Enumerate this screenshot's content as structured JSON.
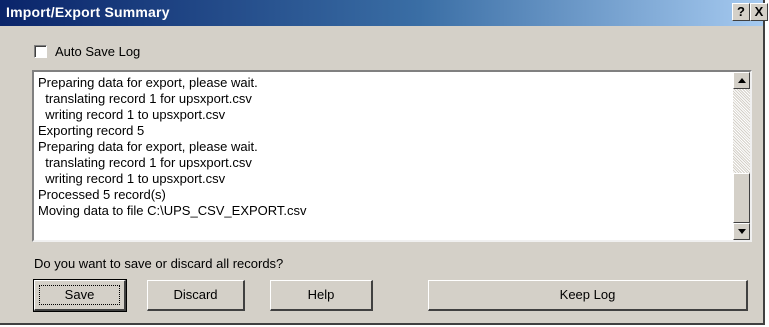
{
  "window": {
    "title": "Import/Export Summary",
    "help_button": "?",
    "close_button": "X"
  },
  "auto_save_log": {
    "label": "Auto Save Log",
    "checked": false
  },
  "log": {
    "lines": [
      "Preparing data for export, please wait.",
      "  translating record 1 for upsxport.csv",
      "  writing record 1 to upsxport.csv",
      "Exporting record 5",
      "Preparing data for export, please wait.",
      "  translating record 1 for upsxport.csv",
      "  writing record 1 to upsxport.csv",
      "Processed 5 record(s)",
      "Moving data to file C:\\UPS_CSV_EXPORT.csv"
    ]
  },
  "prompt": "Do you want to save or discard all records?",
  "buttons": {
    "save": "Save",
    "discard": "Discard",
    "help": "Help",
    "keep_log": "Keep Log"
  }
}
